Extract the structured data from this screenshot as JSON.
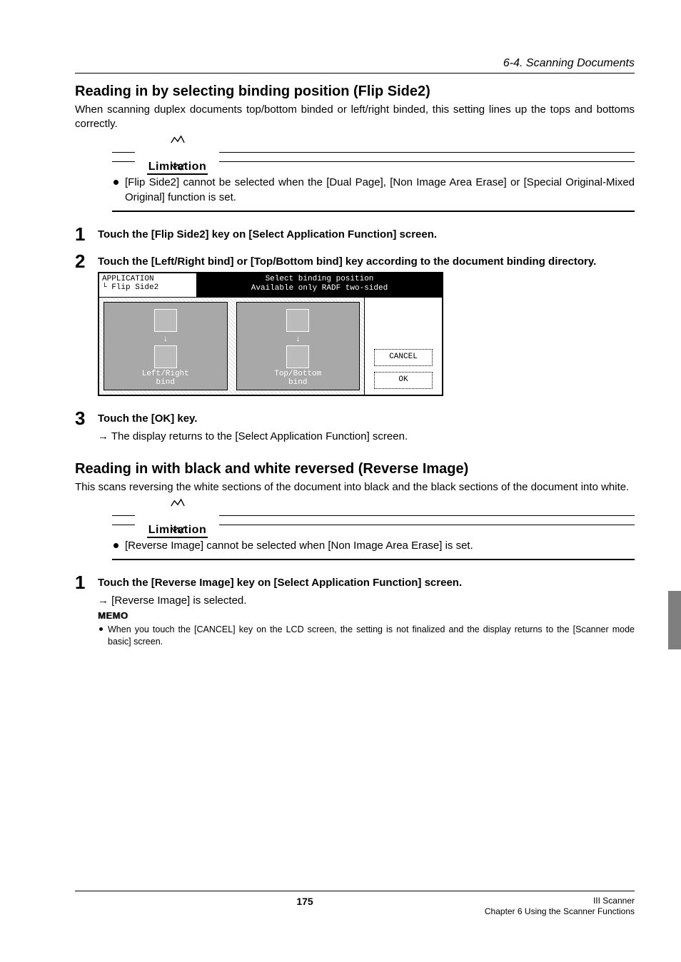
{
  "header_section": "6-4. Scanning Documents",
  "section1": {
    "title": "Reading in by selecting binding position (Flip Side2)",
    "intro": "When scanning duplex documents top/bottom binded or left/right binded, this setting lines up the tops and bottoms correctly.",
    "limitation_label": "Limitation",
    "limitation_item": "[Flip Side2] cannot be selected when the [Dual Page], [Non Image Area Erase] or [Special Original-Mixed Original] function is set.",
    "step1": "Touch the [Flip Side2] key on [Select Application Function] screen.",
    "step2": "Touch the [Left/Right bind] or [Top/Bottom bind] key according to the document binding directory.",
    "step3": "Touch the [OK] key.",
    "step3_result": "→ The display returns to the [Select Application Function] screen."
  },
  "lcd": {
    "app_path1": "APPLICATION",
    "app_path2": "└ Flip Side2",
    "title1": "Select binding position",
    "title2": "Available only RADF two-sided",
    "opt1a": "Left/Right",
    "opt1b": "bind",
    "opt2a": "Top/Bottom",
    "opt2b": "bind",
    "cancel": "CANCEL",
    "ok": "OK"
  },
  "section2": {
    "title": "Reading in with black and white reversed (Reverse Image)",
    "intro": "This scans reversing the white sections of the document into black and the black sections of the document into white.",
    "limitation_label": "Limitation",
    "limitation_item": "[Reverse Image] cannot be selected when [Non Image Area Erase] is set.",
    "step1": "Touch the [Reverse Image] key on [Select Application Function] screen.",
    "step1_result": "→ [Reverse Image] is selected.",
    "memo_label": "MEMO",
    "memo_item": "When you touch the [CANCEL] key on the LCD screen, the setting is not finalized and the display returns to the [Scanner mode basic] screen."
  },
  "footer": {
    "page": "175",
    "right1": "III Scanner",
    "right2": "Chapter 6 Using the Scanner Functions"
  },
  "step_numbers": {
    "n1": "1",
    "n2": "2",
    "n3": "3"
  }
}
